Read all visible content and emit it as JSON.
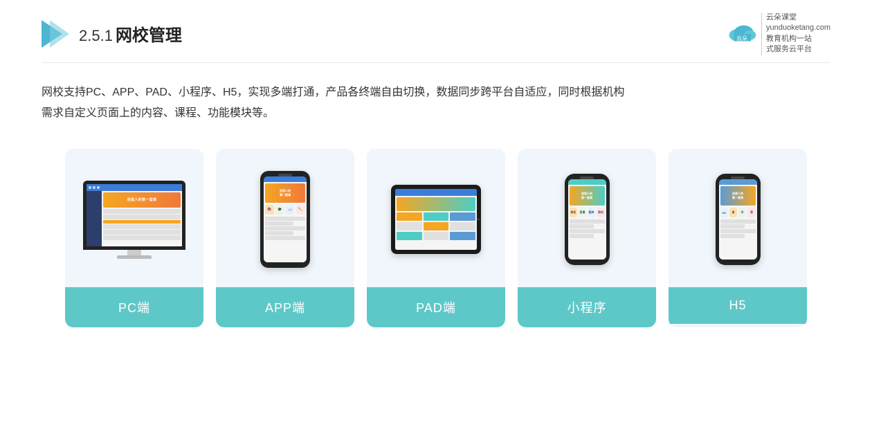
{
  "header": {
    "title_number": "2.5.1",
    "title_main": "网校管理",
    "brand_name": "云朵课堂",
    "brand_website": "yunduoketang.com",
    "brand_tagline1": "教育机构一站",
    "brand_tagline2": "式服务云平台"
  },
  "description": {
    "line1": "网校支持PC、APP、PAD、小程序、H5，实现多端打通，产品各终端自由切换，数据同步跨平台自适应，同时根据机构",
    "line2": "需求自定义页面上的内容、课程、功能模块等。"
  },
  "cards": [
    {
      "id": "pc",
      "label": "PC端"
    },
    {
      "id": "app",
      "label": "APP端"
    },
    {
      "id": "pad",
      "label": "PAD端"
    },
    {
      "id": "miniprogram",
      "label": "小程序"
    },
    {
      "id": "h5",
      "label": "H5"
    }
  ]
}
